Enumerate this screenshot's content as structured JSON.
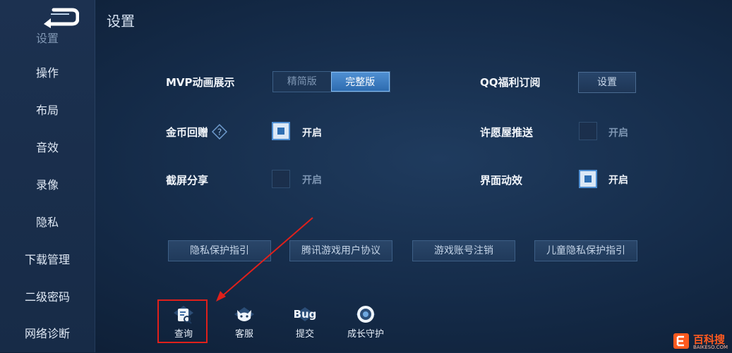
{
  "page": {
    "title": "设置"
  },
  "sidebar": {
    "partial_item": "设置",
    "items": [
      {
        "label": "操作"
      },
      {
        "label": "布局"
      },
      {
        "label": "音效"
      },
      {
        "label": "录像"
      },
      {
        "label": "隐私"
      },
      {
        "label": "下载管理"
      },
      {
        "label": "二级密码"
      },
      {
        "label": "网络诊断"
      }
    ]
  },
  "settings": {
    "mvp": {
      "label": "MVP动画展示",
      "options": [
        "精简版",
        "完整版"
      ],
      "selected": "完整版"
    },
    "qq": {
      "label": "QQ福利订阅",
      "button": "设置"
    },
    "coin": {
      "label": "金币回赠",
      "checked": true,
      "state_label": "开启"
    },
    "wish": {
      "label": "许愿屋推送",
      "checked": false,
      "state_label": "开启"
    },
    "screenshot": {
      "label": "截屏分享",
      "checked": false,
      "state_label": "开启"
    },
    "ui_effects": {
      "label": "界面动效",
      "checked": true,
      "state_label": "开启"
    }
  },
  "links": [
    {
      "label": "隐私保护指引"
    },
    {
      "label": "腾讯游戏用户协议"
    },
    {
      "label": "游戏账号注销"
    },
    {
      "label": "儿童隐私保护指引"
    }
  ],
  "tools": [
    {
      "label": "查询",
      "icon": "document-search-icon"
    },
    {
      "label": "客服",
      "icon": "cat-face-icon"
    },
    {
      "label": "提交",
      "icon": "bug-icon",
      "icon_text": "Bug"
    },
    {
      "label": "成长守护",
      "icon": "ring-shield-icon"
    }
  ],
  "watermark": {
    "name": "百科搜",
    "sub": "BAIKESO.COM"
  },
  "colors": {
    "accent": "#4f8fd2",
    "highlight": "#e0201b",
    "watermark": "#ff5a1f"
  }
}
